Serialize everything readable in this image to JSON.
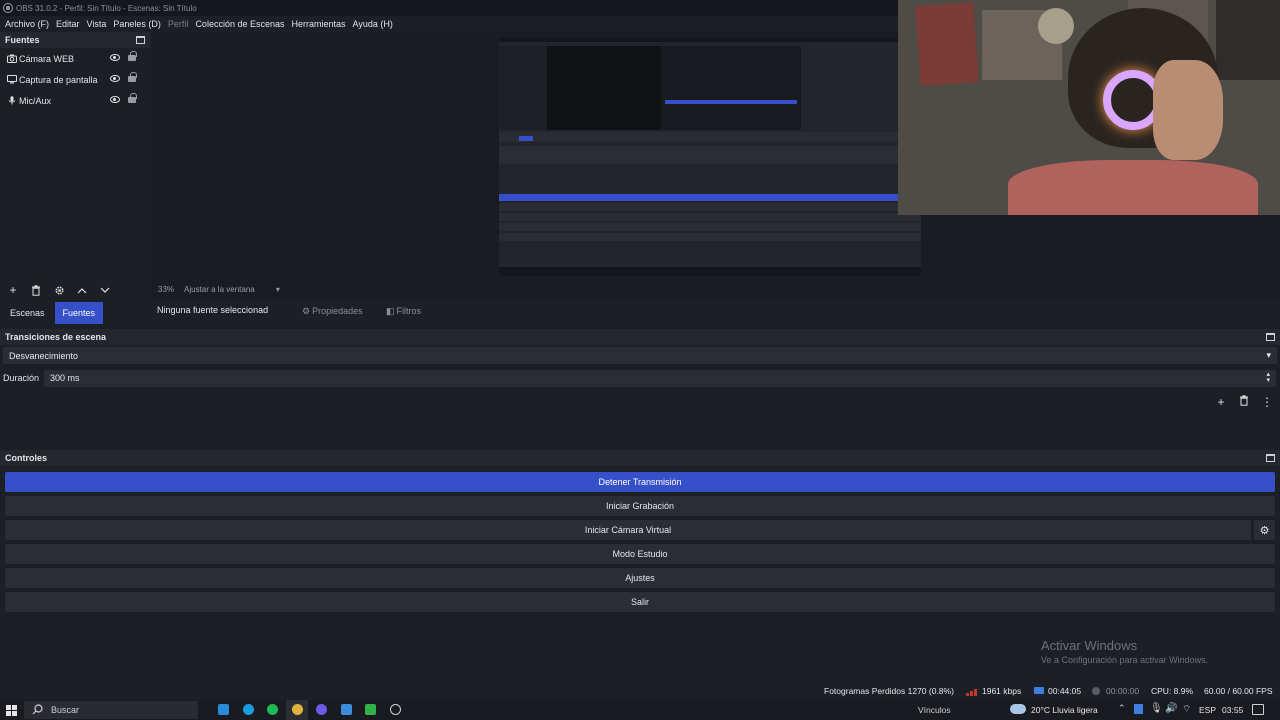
{
  "window": {
    "title": "OBS 31.0.2 - Perfil: Sin Título - Escenas: Sin Título"
  },
  "menu": {
    "items": [
      "Archivo (F)",
      "Editar",
      "Vista",
      "Paneles (D)",
      "Perfil",
      "Colección de Escenas",
      "Herramientas",
      "Ayuda (H)"
    ]
  },
  "sources": {
    "title": "Fuentes",
    "items": [
      {
        "label": "Cámara WEB",
        "icon": "camera-icon"
      },
      {
        "label": "Captura de pantalla",
        "icon": "monitor-icon"
      },
      {
        "label": "Mic/Aux",
        "icon": "microphone-icon"
      }
    ]
  },
  "preview": {
    "zoom": "33%",
    "fit_label": "Ajustar a la ventana"
  },
  "tabs": {
    "scenes": "Escenas",
    "sources": "Fuentes"
  },
  "context_bar": {
    "no_selection": "Ninguna fuente seleccionad",
    "properties": "Propiedades",
    "filters": "Filtros"
  },
  "transitions": {
    "title": "Transiciones de escena",
    "selected": "Desvanecimiento",
    "duration_label": "Duración",
    "duration_value": "300 ms"
  },
  "controls": {
    "title": "Controles",
    "stop_stream": "Detener Transmisión",
    "start_recording": "Iniciar Grabación",
    "start_virtual_cam": "Iniciar Cámara Virtual",
    "studio_mode": "Modo Estudio",
    "settings": "Ajustes",
    "exit": "Salir"
  },
  "activation": {
    "line1": "Activar Windows",
    "line2": "Ve a Configuración para activar Windows."
  },
  "status": {
    "dropped": "Fotogramas Perdidos 1270 (0.8%)",
    "bitrate": "1961 kbps",
    "stream_time": "00:44:05",
    "rec_time": "00:00:00",
    "cpu": "CPU: 8.9%",
    "fps": "60.00 / 60.00 FPS"
  },
  "taskbar": {
    "search": "Buscar",
    "links": "Vínculos",
    "weather": "20°C  Lluvia ligera",
    "lang": "ESP",
    "clock": "03:55"
  },
  "colors": {
    "accent": "#3550c8",
    "panel": "#1d1f26",
    "button": "#2b2d35"
  }
}
